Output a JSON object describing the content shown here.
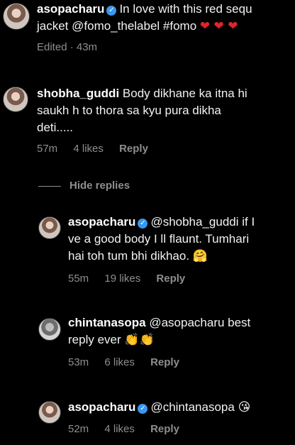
{
  "caption": {
    "username": "asopacharu",
    "text_line1": "In love with this red sequ",
    "text_line2": "jacket @fomo_thelabel  #fomo",
    "hearts": "❤ ❤ ❤",
    "meta": "Edited · 43m"
  },
  "comment1": {
    "username": "shobha_guddi",
    "line1": "Body dikhane ka itna hi",
    "line2": "saukh h to thora sa kyu pura dikha",
    "line3": "deti.....",
    "time": "57m",
    "likes": "4 likes",
    "reply": "Reply"
  },
  "hide_replies": "Hide replies",
  "reply1": {
    "username": "asopacharu",
    "line1": "@shobha_guddi if I",
    "line2": "ve a good body I ll flaunt. Tumhari",
    "line3": "hai toh tum bhi dikhao.",
    "emoji": "🤗",
    "time": "55m",
    "likes": "19 likes",
    "reply": "Reply"
  },
  "reply2": {
    "username": "chintanasopa",
    "line1": "@asopacharu best",
    "line2": "reply ever",
    "emoji": "👏👏",
    "time": "53m",
    "likes": "6 likes",
    "reply": "Reply"
  },
  "reply3": {
    "username": "asopacharu",
    "line1": "@chintanasopa",
    "emoji": "😘",
    "time": "52m",
    "likes": "4 likes",
    "reply": "Reply"
  },
  "colors": {
    "background": "#000000",
    "text": "#f2f2f2",
    "meta": "#8e8e8e",
    "verified": "#3897f0",
    "heart": "#e0242c"
  }
}
